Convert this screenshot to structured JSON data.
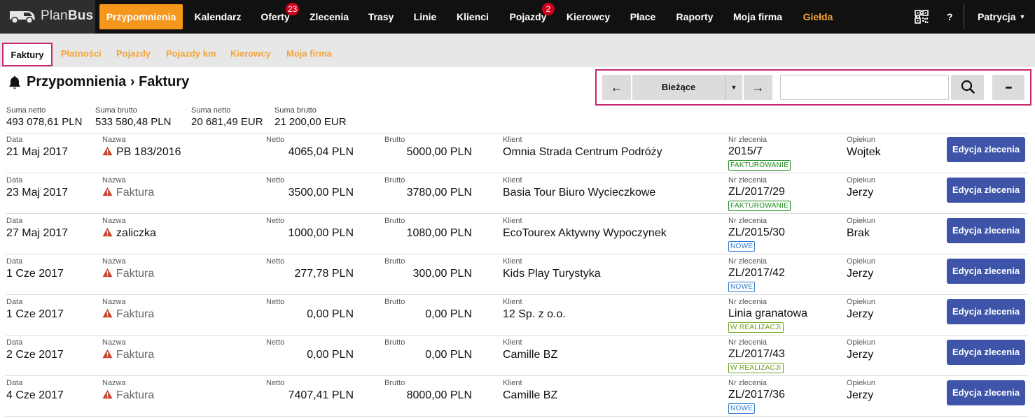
{
  "brand": {
    "name_light": "Plan",
    "name_bold": "Bus"
  },
  "nav": {
    "items": [
      {
        "label": "Przypomnienia",
        "active": true
      },
      {
        "label": "Kalendarz"
      },
      {
        "label": "Oferty",
        "badge": "23"
      },
      {
        "label": "Zlecenia"
      },
      {
        "label": "Trasy"
      },
      {
        "label": "Linie"
      },
      {
        "label": "Klienci"
      },
      {
        "label": "Pojazdy",
        "badge": "2"
      },
      {
        "label": "Kierowcy"
      },
      {
        "label": "Płace"
      },
      {
        "label": "Raporty"
      },
      {
        "label": "Moja firma"
      },
      {
        "label": "Giełda"
      }
    ],
    "help": "?",
    "user": "Patrycja"
  },
  "subnav": {
    "items": [
      {
        "label": "Faktury",
        "active": true
      },
      {
        "label": "Płatności"
      },
      {
        "label": "Pojazdy"
      },
      {
        "label": "Pojazdy km"
      },
      {
        "label": "Kierowcy"
      },
      {
        "label": "Moja firma"
      }
    ]
  },
  "page": {
    "section": "Przypomnienia",
    "separator": "›",
    "title": "Faktury"
  },
  "toolbar": {
    "prev": "←",
    "period": "Bieżące",
    "next": "→",
    "search_value": "",
    "more": "•••"
  },
  "summary": [
    {
      "label": "Suma netto",
      "value": "493 078,61 PLN"
    },
    {
      "label": "Suma brutto",
      "value": "533 580,48 PLN"
    },
    {
      "label": "Suma netto",
      "value": "20 681,49 EUR"
    },
    {
      "label": "Suma brutto",
      "value": "21 200,00 EUR"
    }
  ],
  "columns": {
    "data": "Data",
    "nazwa": "Nazwa",
    "netto": "Netto",
    "brutto": "Brutto",
    "klient": "Klient",
    "nr": "Nr zlecenia",
    "opiekun": "Opiekun"
  },
  "edit_label": "Edycja zlecenia",
  "rows": [
    {
      "data": "21 Maj 2017",
      "nazwa": "PB 183/2016",
      "muted": false,
      "netto": "4065,04 PLN",
      "brutto": "5000,00 PLN",
      "klient": "Omnia Strada Centrum Podróży",
      "nr": "2015/7",
      "status": "FAKTUROWANIE",
      "status_kind": "fakt",
      "opiekun": "Wojtek"
    },
    {
      "data": "23 Maj 2017",
      "nazwa": "Faktura",
      "muted": true,
      "netto": "3500,00 PLN",
      "brutto": "3780,00 PLN",
      "klient": "Basia Tour Biuro Wycieczkowe",
      "nr": "ZL/2017/29",
      "status": "FAKTUROWANIE",
      "status_kind": "fakt",
      "opiekun": "Jerzy"
    },
    {
      "data": "27 Maj 2017",
      "nazwa": "zaliczka",
      "muted": false,
      "netto": "1000,00 PLN",
      "brutto": "1080,00 PLN",
      "klient": "EcoTourex Aktywny Wypoczynek",
      "nr": "ZL/2015/30",
      "status": "NOWE",
      "status_kind": "nowe",
      "opiekun": "Brak"
    },
    {
      "data": "1 Cze 2017",
      "nazwa": "Faktura",
      "muted": true,
      "netto": "277,78 PLN",
      "brutto": "300,00 PLN",
      "klient": "Kids Play Turystyka",
      "nr": "ZL/2017/42",
      "status": "NOWE",
      "status_kind": "nowe",
      "opiekun": "Jerzy"
    },
    {
      "data": "1 Cze 2017",
      "nazwa": "Faktura",
      "muted": true,
      "netto": "0,00 PLN",
      "brutto": "0,00 PLN",
      "klient": "12 Sp. z o.o.",
      "nr": "Linia granatowa",
      "status": "W REALIZACJI",
      "status_kind": "real",
      "opiekun": "Jerzy"
    },
    {
      "data": "2 Cze 2017",
      "nazwa": "Faktura",
      "muted": true,
      "netto": "0,00 PLN",
      "brutto": "0,00 PLN",
      "klient": "Camille BZ",
      "nr": "ZL/2017/43",
      "status": "W REALIZACJI",
      "status_kind": "real",
      "opiekun": "Jerzy"
    },
    {
      "data": "4 Cze 2017",
      "nazwa": "Faktura",
      "muted": true,
      "netto": "7407,41 PLN",
      "brutto": "8000,00 PLN",
      "klient": "Camille BZ",
      "nr": "ZL/2017/36",
      "status": "NOWE",
      "status_kind": "nowe",
      "opiekun": "Jerzy"
    }
  ]
}
